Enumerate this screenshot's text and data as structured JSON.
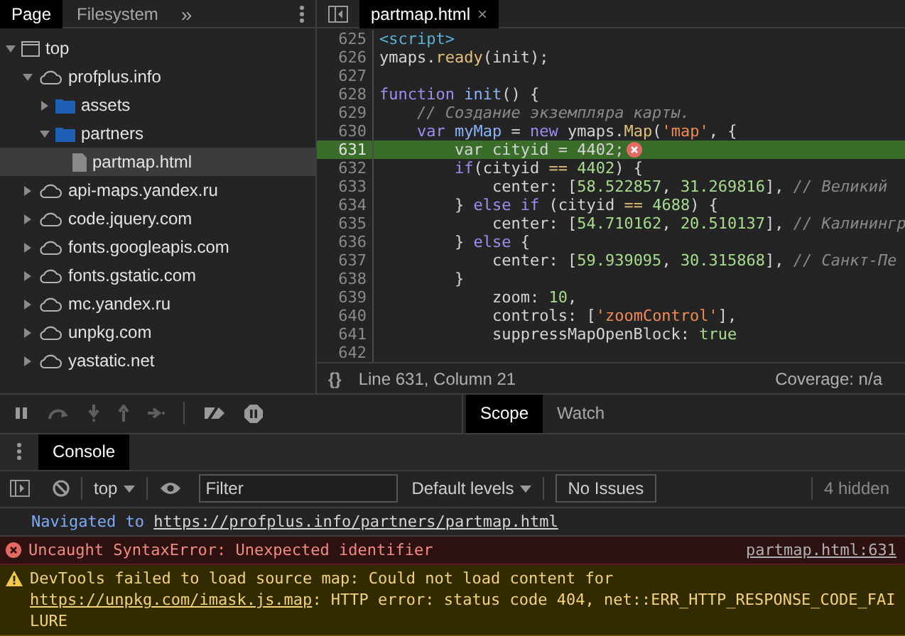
{
  "navigator": {
    "tabs": [
      {
        "label": "Page",
        "selected": true
      },
      {
        "label": "Filesystem",
        "selected": false
      }
    ],
    "more": "»",
    "tree": [
      {
        "label": "top",
        "kind": "frame",
        "expanded": true,
        "selected": false,
        "children": [
          {
            "label": "profplus.info",
            "kind": "domain",
            "expanded": true,
            "selected": false,
            "children": [
              {
                "label": "assets",
                "kind": "folder",
                "expanded": false,
                "selected": false
              },
              {
                "label": "partners",
                "kind": "folder",
                "expanded": true,
                "selected": false,
                "children": [
                  {
                    "label": "partmap.html",
                    "kind": "file",
                    "selected": true
                  }
                ]
              }
            ]
          },
          {
            "label": "api-maps.yandex.ru",
            "kind": "domain",
            "expanded": false,
            "selected": false
          },
          {
            "label": "code.jquery.com",
            "kind": "domain",
            "expanded": false,
            "selected": false
          },
          {
            "label": "fonts.googleapis.com",
            "kind": "domain",
            "expanded": false,
            "selected": false
          },
          {
            "label": "fonts.gstatic.com",
            "kind": "domain",
            "expanded": false,
            "selected": false
          },
          {
            "label": "mc.yandex.ru",
            "kind": "domain",
            "expanded": false,
            "selected": false
          },
          {
            "label": "unpkg.com",
            "kind": "domain",
            "expanded": false,
            "selected": false
          },
          {
            "label": "yastatic.net",
            "kind": "domain",
            "expanded": false,
            "selected": false
          }
        ]
      }
    ]
  },
  "editor": {
    "tab": {
      "label": "partmap.html",
      "close": "×"
    },
    "lines": [
      {
        "number": "625",
        "highlighted": false,
        "error": false,
        "tokens": [
          {
            "t": "<script>",
            "kind": "tag"
          }
        ]
      },
      {
        "number": "626",
        "highlighted": false,
        "error": false,
        "tokens": [
          {
            "t": "ymaps.",
            "kind": "plain"
          },
          {
            "t": "ready",
            "kind": "func"
          },
          {
            "t": "(init);",
            "kind": "plain"
          }
        ]
      },
      {
        "number": "627",
        "highlighted": false,
        "error": false
      },
      {
        "number": "628",
        "highlighted": false,
        "error": false,
        "tokens": [
          {
            "t": "function",
            "kind": "keyword"
          },
          {
            "t": " init",
            "kind": "def"
          },
          {
            "t": "() {",
            "kind": "plain"
          }
        ]
      },
      {
        "number": "629",
        "highlighted": false,
        "error": false,
        "tokens": [
          {
            "t": "    // Создание экземпляра карты.",
            "kind": "comment"
          }
        ]
      },
      {
        "number": "630",
        "highlighted": false,
        "error": false,
        "tokens": [
          {
            "t": "    var",
            "kind": "keyword"
          },
          {
            "t": " myMap",
            "kind": "def"
          },
          {
            "t": " = ",
            "kind": "plain"
          },
          {
            "t": "new",
            "kind": "keyword"
          },
          {
            "t": " ymaps.",
            "kind": "plain"
          },
          {
            "t": "Map",
            "kind": "func"
          },
          {
            "t": "(",
            "kind": "plain"
          },
          {
            "t": "'map'",
            "kind": "string"
          },
          {
            "t": ", {",
            "kind": "plain"
          }
        ]
      },
      {
        "number": "631",
        "highlighted": true,
        "error": true,
        "tokens": [
          {
            "t": "        var cityid = 4402;",
            "kind": "plain"
          }
        ]
      },
      {
        "number": "632",
        "highlighted": false,
        "error": false,
        "tokens": [
          {
            "t": "        if",
            "kind": "keyword"
          },
          {
            "t": "(cityid ",
            "kind": "plain"
          },
          {
            "t": "==",
            "kind": "op"
          },
          {
            "t": " 4402",
            "kind": "number"
          },
          {
            "t": ") {",
            "kind": "plain"
          }
        ]
      },
      {
        "number": "633",
        "highlighted": false,
        "error": false,
        "tokens": [
          {
            "t": "            center: [",
            "kind": "plain"
          },
          {
            "t": "58.522857",
            "kind": "number"
          },
          {
            "t": ", ",
            "kind": "plain"
          },
          {
            "t": "31.269816",
            "kind": "number"
          },
          {
            "t": "], ",
            "kind": "plain"
          },
          {
            "t": "// Великий",
            "kind": "comment"
          }
        ]
      },
      {
        "number": "634",
        "highlighted": false,
        "error": false,
        "tokens": [
          {
            "t": "        } ",
            "kind": "plain"
          },
          {
            "t": "else if",
            "kind": "keyword"
          },
          {
            "t": " (cityid ",
            "kind": "plain"
          },
          {
            "t": "==",
            "kind": "op"
          },
          {
            "t": " 4688",
            "kind": "number"
          },
          {
            "t": ") {",
            "kind": "plain"
          }
        ]
      },
      {
        "number": "635",
        "highlighted": false,
        "error": false,
        "tokens": [
          {
            "t": "            center: [",
            "kind": "plain"
          },
          {
            "t": "54.710162",
            "kind": "number"
          },
          {
            "t": ", ",
            "kind": "plain"
          },
          {
            "t": "20.510137",
            "kind": "number"
          },
          {
            "t": "], ",
            "kind": "plain"
          },
          {
            "t": "// Калинингр",
            "kind": "comment"
          }
        ]
      },
      {
        "number": "636",
        "highlighted": false,
        "error": false,
        "tokens": [
          {
            "t": "        } ",
            "kind": "plain"
          },
          {
            "t": "else",
            "kind": "keyword"
          },
          {
            "t": " {",
            "kind": "plain"
          }
        ]
      },
      {
        "number": "637",
        "highlighted": false,
        "error": false,
        "tokens": [
          {
            "t": "            center: [",
            "kind": "plain"
          },
          {
            "t": "59.939095",
            "kind": "number"
          },
          {
            "t": ", ",
            "kind": "plain"
          },
          {
            "t": "30.315868",
            "kind": "number"
          },
          {
            "t": "], ",
            "kind": "plain"
          },
          {
            "t": "// Санкт-Пе",
            "kind": "comment"
          }
        ]
      },
      {
        "number": "638",
        "highlighted": false,
        "error": false,
        "tokens": [
          {
            "t": "        }",
            "kind": "plain"
          }
        ]
      },
      {
        "number": "639",
        "highlighted": false,
        "error": false,
        "tokens": [
          {
            "t": "            zoom: ",
            "kind": "plain"
          },
          {
            "t": "10",
            "kind": "number"
          },
          {
            "t": ",",
            "kind": "plain"
          }
        ]
      },
      {
        "number": "640",
        "highlighted": false,
        "error": false,
        "tokens": [
          {
            "t": "            controls: [",
            "kind": "plain"
          },
          {
            "t": "'zoomControl'",
            "kind": "string"
          },
          {
            "t": "],",
            "kind": "plain"
          }
        ]
      },
      {
        "number": "641",
        "highlighted": false,
        "error": false,
        "tokens": [
          {
            "t": "            suppressMapOpenBlock: ",
            "kind": "plain"
          },
          {
            "t": "true",
            "kind": "atom"
          }
        ]
      },
      {
        "number": "642",
        "highlighted": false,
        "error": false
      }
    ],
    "status": {
      "format": "{}",
      "position": "Line 631, Column 21",
      "coverage": "Coverage: n/a"
    }
  },
  "debugger": {
    "tabs": [
      {
        "label": "Scope",
        "selected": true
      },
      {
        "label": "Watch",
        "selected": false
      }
    ]
  },
  "drawer": {
    "tabs": [
      {
        "label": "Console",
        "selected": true
      }
    ],
    "toolbar": {
      "context": "top",
      "filter_placeholder": "Filter",
      "levels": "Default levels",
      "issues": "No Issues",
      "hidden": "4 hidden"
    },
    "messages": [
      {
        "kind": "info",
        "parts": [
          {
            "t": "Navigated to ",
            "link": false
          },
          {
            "t": "https://profplus.info/partners/partmap.html",
            "link": true
          }
        ]
      },
      {
        "kind": "error",
        "parts": [
          {
            "t": "Uncaught SyntaxError: Unexpected identifier",
            "link": false
          }
        ],
        "source": "partmap.html:631"
      },
      {
        "kind": "warning",
        "parts": [
          {
            "t": "DevTools failed to load source map: Could not load content for ",
            "link": false
          },
          {
            "t": "https://unpkg.com/imask.js.map",
            "link": true
          },
          {
            "t": ": HTTP error: status code 404, net::ERR_HTTP_RESPONSE_CODE_FAILURE",
            "link": false
          }
        ]
      }
    ]
  }
}
